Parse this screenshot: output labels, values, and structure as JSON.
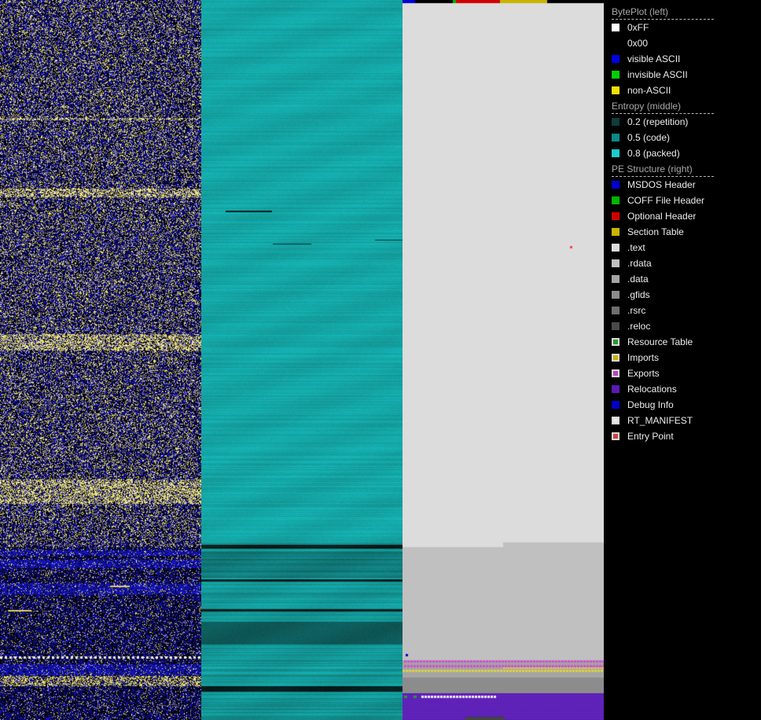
{
  "legend": {
    "byteplot": {
      "title": "BytePlot (left)",
      "items": [
        {
          "label": "0xFF",
          "color": "#ffffff",
          "outlined": false,
          "icon": "white-swatch"
        },
        {
          "label": "0x00",
          "color": "#000000",
          "outlined": false,
          "icon": "black-swatch"
        },
        {
          "label": "visible ASCII",
          "color": "#0000e6",
          "outlined": false,
          "icon": "blue-swatch"
        },
        {
          "label": "invisible ASCII",
          "color": "#00d000",
          "outlined": false,
          "icon": "green-swatch"
        },
        {
          "label": "non-ASCII",
          "color": "#f0e000",
          "outlined": false,
          "icon": "yellow-swatch"
        }
      ]
    },
    "entropy": {
      "title": "Entropy (middle)",
      "items": [
        {
          "label": "0.2 (repetition)",
          "color": "#0f3c3c",
          "outlined": false,
          "icon": "dark-teal-swatch"
        },
        {
          "label": "0.5 (code)",
          "color": "#0e8888",
          "outlined": false,
          "icon": "teal-swatch"
        },
        {
          "label": "0.8 (packed)",
          "color": "#1ccccc",
          "outlined": false,
          "icon": "cyan-swatch"
        }
      ]
    },
    "pe": {
      "title": "PE Structure (right)",
      "items": [
        {
          "label": "MSDOS Header",
          "color": "#0000d0",
          "outlined": false,
          "icon": "blue-swatch"
        },
        {
          "label": "COFF File Header",
          "color": "#00b400",
          "outlined": false,
          "icon": "green-swatch"
        },
        {
          "label": "Optional Header",
          "color": "#d00000",
          "outlined": false,
          "icon": "red-swatch"
        },
        {
          "label": "Section Table",
          "color": "#c8b400",
          "outlined": false,
          "icon": "olive-swatch"
        },
        {
          "label": ".text",
          "color": "#dcdcdc",
          "outlined": false,
          "icon": "light-gray-swatch"
        },
        {
          "label": ".rdata",
          "color": "#c0c0c0",
          "outlined": false,
          "icon": "gray-swatch"
        },
        {
          "label": ".data",
          "color": "#a4a4a4",
          "outlined": false,
          "icon": "gray-swatch"
        },
        {
          "label": ".gfids",
          "color": "#8c8c8c",
          "outlined": false,
          "icon": "gray-swatch"
        },
        {
          "label": ".rsrc",
          "color": "#6e6e6e",
          "outlined": false,
          "icon": "dark-gray-swatch"
        },
        {
          "label": ".reloc",
          "color": "#4a4a4a",
          "outlined": false,
          "icon": "dark-gray-swatch"
        },
        {
          "label": "Resource Table",
          "color": "#2a9a2a",
          "outlined": true,
          "icon": "outlined-green-swatch"
        },
        {
          "label": "Imports",
          "color": "#c8b400",
          "outlined": true,
          "icon": "outlined-yellow-swatch"
        },
        {
          "label": "Exports",
          "color": "#c040c0",
          "outlined": true,
          "icon": "outlined-magenta-swatch"
        },
        {
          "label": "Relocations",
          "color": "#5a1ab4",
          "outlined": false,
          "icon": "purple-swatch"
        },
        {
          "label": "Debug Info",
          "color": "#0000c8",
          "outlined": false,
          "icon": "blue-swatch"
        },
        {
          "label": "RT_MANIFEST",
          "color": "#e8e8e8",
          "outlined": true,
          "icon": "outlined-white-swatch"
        },
        {
          "label": "Entry Point",
          "color": "#d04040",
          "outlined": true,
          "icon": "outlined-red-swatch"
        }
      ]
    }
  }
}
